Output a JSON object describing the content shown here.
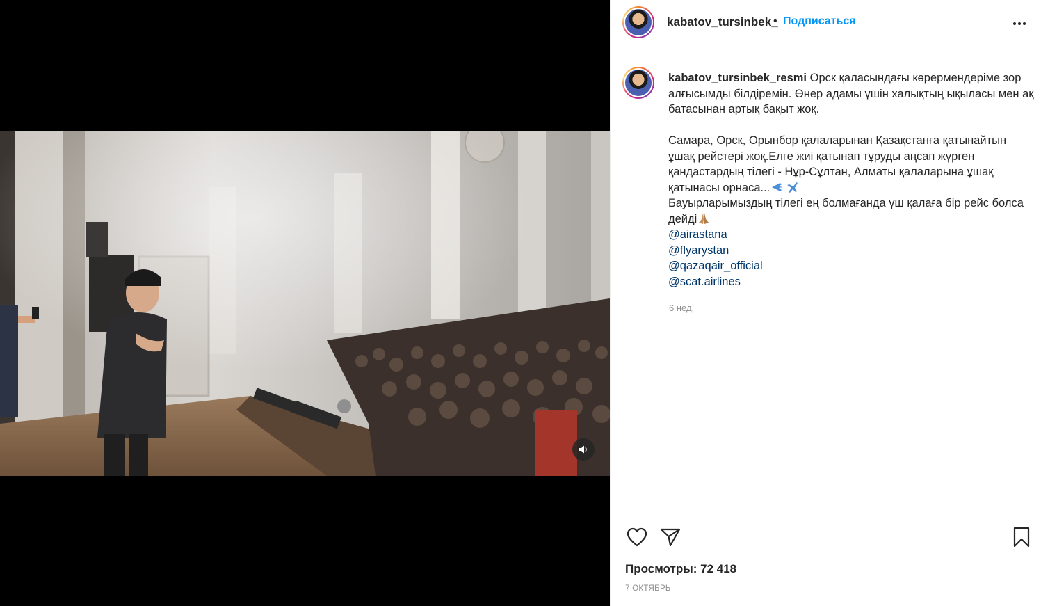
{
  "post": {
    "username_header": "kabatov_tursinbek_",
    "separator": "•",
    "follow_label": "Подписаться",
    "caption_author": "kabatov_tursinbek_resmi",
    "caption_lines": [
      "Орск қаласындағы көрермендеріме зор алғысымды білдіремін. Өнер адамы үшін халықтың ықыласы мен ақ батасынан артық бақыт жоқ."
    ],
    "caption_paragraph2": "Самара, Орск, Орынбор қалаларынан Қазақстанға қатынайтын ұшақ рейстері жоқ.Елге жиі қатынап тұруды аңсап жүрген қандастардың тілегі - Нұр-Сұлтан, Алматы қалаларына ұшақ қатынасы орнаса...",
    "caption_paragraph3": "Бауырларымыздың тілегі ең болмағанда үш қалаға бір рейс болса дейді",
    "mentions": [
      "@airastana",
      "@flyarystan",
      "@qazaqair_official",
      "@scat.airlines"
    ],
    "time_ago": "6 нед.",
    "views": "Просмотры: 72 418",
    "date": "7 октябрь"
  },
  "icons": {
    "more": "more-options-icon",
    "like": "heart-icon",
    "share": "paper-plane-icon",
    "save": "bookmark-icon",
    "sound": "speaker-icon",
    "emojis": [
      "airplane-emoji",
      "praying-hands-emoji"
    ]
  },
  "colors": {
    "link_blue": "#0095f6",
    "mention_blue": "#00376b",
    "muted": "#8e8e8e",
    "text": "#262626"
  }
}
